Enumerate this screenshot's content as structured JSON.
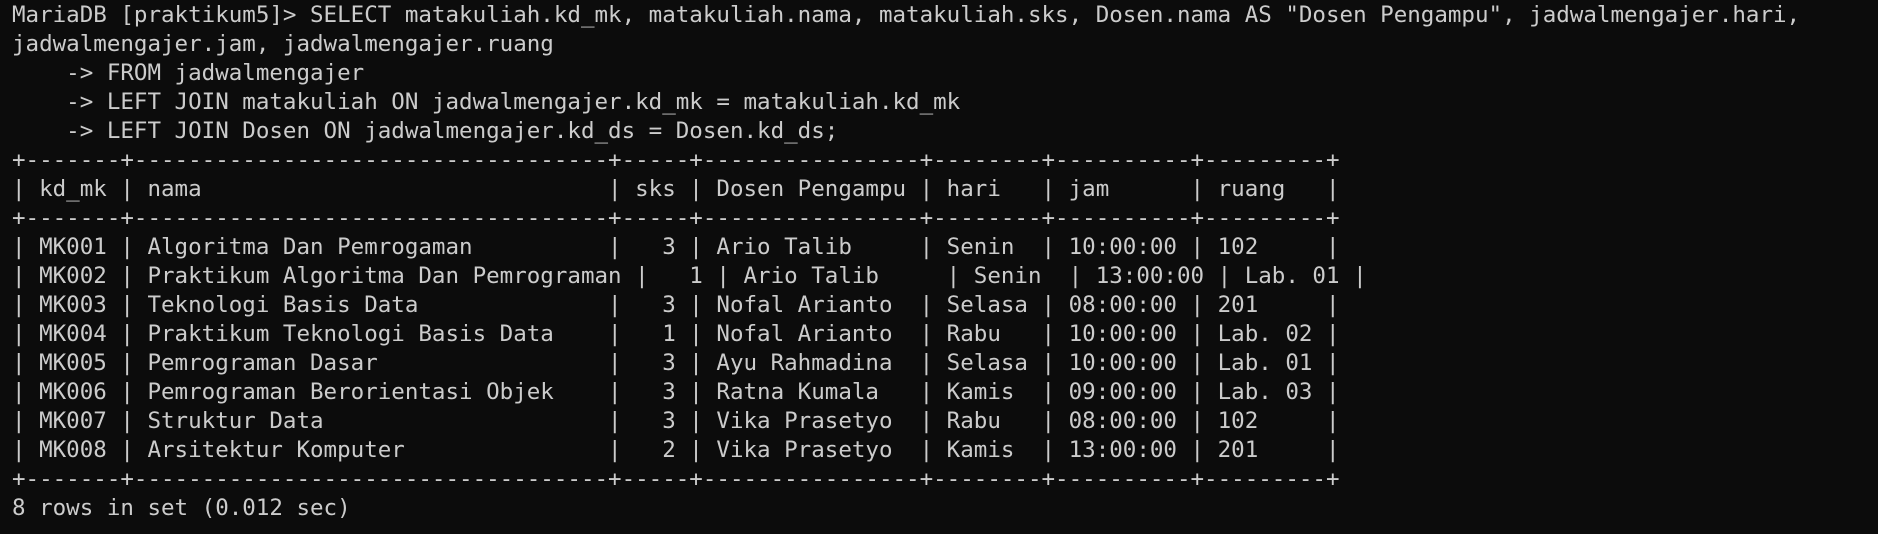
{
  "terminal": {
    "lines": [
      "MariaDB [praktikum5]> SELECT matakuliah.kd_mk, matakuliah.nama, matakuliah.sks, Dosen.nama AS \"Dosen Pengampu\", jadwalmengajer.hari,",
      "jadwalmengajer.jam, jadwalmengajer.ruang",
      "    -> FROM jadwalmengajer",
      "    -> LEFT JOIN matakuliah ON jadwalmengajer.kd_mk = matakuliah.kd_mk",
      "    -> LEFT JOIN Dosen ON jadwalmengajer.kd_ds = Dosen.kd_ds;",
      "+-------+-----------------------------------+-----+----------------+--------+----------+---------+",
      "| kd_mk | nama                              | sks | Dosen Pengampu | hari   | jam      | ruang   |",
      "+-------+-----------------------------------+-----+----------------+--------+----------+---------+",
      "| MK001 | Algoritma Dan Pemrogaman          |   3 | Ario Talib     | Senin  | 10:00:00 | 102     |",
      "| MK002 | Praktikum Algoritma Dan Pemrograman |   1 | Ario Talib     | Senin  | 13:00:00 | Lab. 01 |",
      "| MK003 | Teknologi Basis Data              |   3 | Nofal Arianto  | Selasa | 08:00:00 | 201     |",
      "| MK004 | Praktikum Teknologi Basis Data    |   1 | Nofal Arianto  | Rabu   | 10:00:00 | Lab. 02 |",
      "| MK005 | Pemrograman Dasar                 |   3 | Ayu Rahmadina  | Selasa | 10:00:00 | Lab. 01 |",
      "| MK006 | Pemrograman Berorientasi Objek    |   3 | Ratna Kumala   | Kamis  | 09:00:00 | Lab. 03 |",
      "| MK007 | Struktur Data                     |   3 | Vika Prasetyo  | Rabu   | 08:00:00 | 102     |",
      "| MK008 | Arsitektur Komputer               |   2 | Vika Prasetyo  | Kamis  | 13:00:00 | 201     |",
      "+-------+-----------------------------------+-----+----------------+--------+----------+---------+",
      "8 rows in set (0.012 sec)"
    ]
  }
}
